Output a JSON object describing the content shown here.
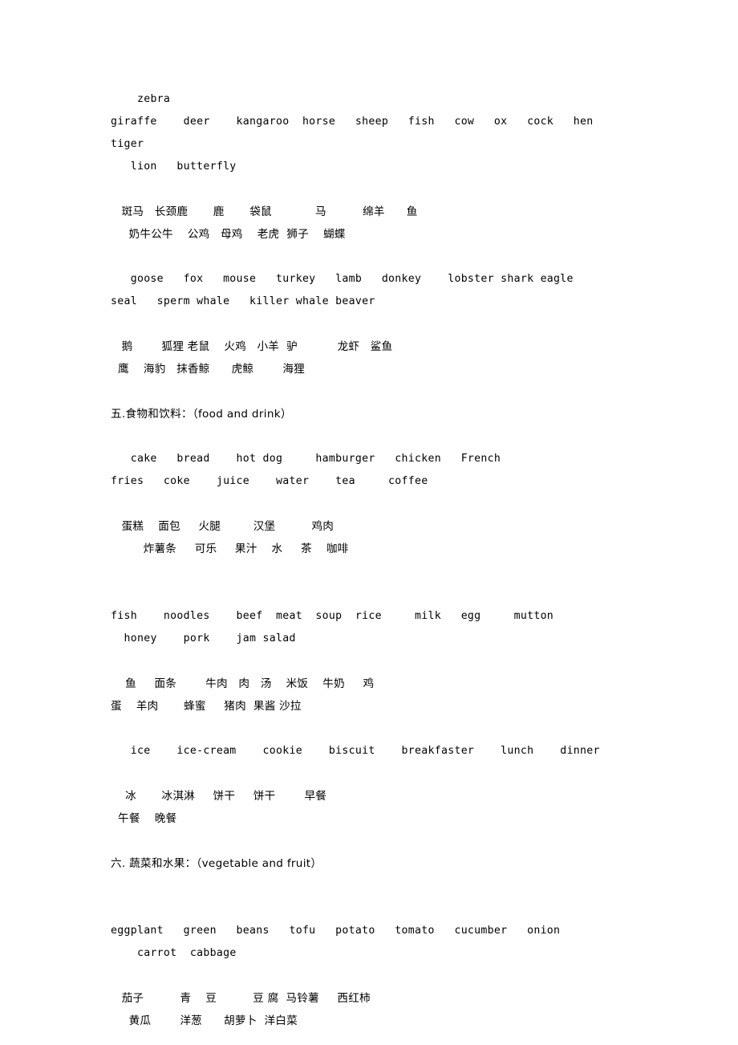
{
  "document": {
    "blocks": [
      {
        "id": "animals-en-1",
        "kind": "english-wordlist",
        "lines": [
          "    zebra",
          "giraffe    deer    kangaroo  horse   sheep   fish   cow   ox   cock   hen   tiger",
          "   lion   butterfly"
        ]
      },
      {
        "id": "gap-1",
        "kind": "blank",
        "lines": [
          ""
        ]
      },
      {
        "id": "animals-cn-1",
        "kind": "chinese-wordlist",
        "lines": [
          "   斑马   长颈鹿       鹿       袋鼠            马          绵羊      鱼",
          "     奶牛公牛    公鸡   母鸡    老虎  狮子    蝴蝶"
        ]
      },
      {
        "id": "gap-2",
        "kind": "blank",
        "lines": [
          ""
        ]
      },
      {
        "id": "animals-en-2",
        "kind": "english-wordlist",
        "lines": [
          "   goose   fox   mouse   turkey   lamb   donkey    lobster shark eagle",
          "seal   sperm whale   killer whale beaver"
        ]
      },
      {
        "id": "gap-3",
        "kind": "blank",
        "lines": [
          ""
        ]
      },
      {
        "id": "animals-cn-2",
        "kind": "chinese-wordlist",
        "lines": [
          "   鹅        狐狸 老鼠    火鸡   小羊  驴           龙虾   鲨鱼",
          "  鹰    海豹   抹香鲸      虎鲸        海狸"
        ]
      },
      {
        "id": "gap-4",
        "kind": "blank",
        "lines": [
          ""
        ]
      },
      {
        "id": "heading-food",
        "kind": "heading",
        "lines": [
          "五.食物和饮料：（food and drink）"
        ]
      },
      {
        "id": "gap-5",
        "kind": "blank",
        "lines": [
          ""
        ]
      },
      {
        "id": "food-en-1",
        "kind": "english-wordlist",
        "lines": [
          "   cake   bread    hot dog     hamburger   chicken   French",
          "fries   coke    juice    water    tea     coffee"
        ]
      },
      {
        "id": "gap-6",
        "kind": "blank",
        "lines": [
          ""
        ]
      },
      {
        "id": "food-cn-1",
        "kind": "chinese-wordlist",
        "lines": [
          "   蛋糕    面包     火腿         汉堡          鸡肉",
          "         炸薯条     可乐     果汁    水     茶    咖啡"
        ]
      },
      {
        "id": "gap-7",
        "kind": "blank",
        "lines": [
          "",
          ""
        ]
      },
      {
        "id": "food-en-2",
        "kind": "english-wordlist",
        "lines": [
          "fish    noodles    beef  meat  soup  rice     milk   egg     mutton",
          "  honey    pork    jam salad"
        ]
      },
      {
        "id": "gap-8",
        "kind": "blank",
        "lines": [
          ""
        ]
      },
      {
        "id": "food-cn-2",
        "kind": "chinese-wordlist",
        "lines": [
          "    鱼     面条        牛肉   肉   汤    米饭    牛奶     鸡",
          "蛋    羊肉       蜂蜜     猪肉  果酱 沙拉"
        ]
      },
      {
        "id": "gap-9",
        "kind": "blank",
        "lines": [
          ""
        ]
      },
      {
        "id": "food-en-3",
        "kind": "english-wordlist",
        "lines": [
          "   ice    ice-cream    cookie    biscuit    breakfaster    lunch    dinner"
        ]
      },
      {
        "id": "gap-10",
        "kind": "blank",
        "lines": [
          ""
        ]
      },
      {
        "id": "food-cn-3",
        "kind": "chinese-wordlist",
        "lines": [
          "    冰       冰淇淋     饼干     饼干        早餐",
          "  午餐    晚餐"
        ]
      },
      {
        "id": "gap-11",
        "kind": "blank",
        "lines": [
          ""
        ]
      },
      {
        "id": "heading-vegetable",
        "kind": "heading",
        "lines": [
          "六. 蔬菜和水果：（vegetable and fruit）"
        ]
      },
      {
        "id": "gap-12",
        "kind": "blank",
        "lines": [
          "",
          ""
        ]
      },
      {
        "id": "veg-en-1",
        "kind": "english-wordlist",
        "lines": [
          "eggplant   green   beans   tofu   potato   tomato   cucumber   onion",
          "    carrot  cabbage"
        ]
      },
      {
        "id": "gap-13",
        "kind": "blank",
        "lines": [
          ""
        ]
      },
      {
        "id": "veg-cn-1",
        "kind": "chinese-wordlist",
        "lines": [
          "   茄子          青    豆          豆 腐  马铃薯     西红柿",
          "     黄瓜        洋葱      胡萝卜  洋白菜"
        ]
      }
    ],
    "vocabulary": {
      "sections": [
        {
          "section_number": "",
          "title_cn": "",
          "title_en": "",
          "english_terms": [
            "zebra",
            "giraffe",
            "deer",
            "kangaroo",
            "horse",
            "sheep",
            "fish",
            "cow",
            "ox",
            "cock",
            "hen",
            "tiger",
            "lion",
            "butterfly"
          ],
          "chinese_terms": [
            "斑马",
            "长颈鹿",
            "鹿",
            "袋鼠",
            "马",
            "绵羊",
            "鱼",
            "奶牛",
            "公牛",
            "公鸡",
            "母鸡",
            "老虎",
            "狮子",
            "蝴蝶"
          ]
        },
        {
          "section_number": "",
          "title_cn": "",
          "title_en": "",
          "english_terms": [
            "goose",
            "fox",
            "mouse",
            "turkey",
            "lamb",
            "donkey",
            "lobster",
            "shark",
            "eagle",
            "seal",
            "sperm whale",
            "killer whale",
            "beaver"
          ],
          "chinese_terms": [
            "鹅",
            "狐狸",
            "老鼠",
            "火鸡",
            "小羊",
            "驴",
            "龙虾",
            "鲨鱼",
            "鹰",
            "海豹",
            "抹香鲸",
            "虎鲸",
            "海狸"
          ]
        },
        {
          "section_number": "五.",
          "title_cn": "食物和饮料：",
          "title_en": "（food and drink）",
          "english_terms": [
            "cake",
            "bread",
            "hot dog",
            "hamburger",
            "chicken",
            "French fries",
            "coke",
            "juice",
            "water",
            "tea",
            "coffee",
            "fish",
            "noodles",
            "beef",
            "meat",
            "soup",
            "rice",
            "milk",
            "egg",
            "mutton",
            "honey",
            "pork",
            "jam",
            "salad",
            "ice",
            "ice-cream",
            "cookie",
            "biscuit",
            "breakfaster",
            "lunch",
            "dinner"
          ],
          "chinese_terms": [
            "蛋糕",
            "面包",
            "火腿",
            "汉堡",
            "鸡肉",
            "炸薯条",
            "可乐",
            "果汁",
            "水",
            "茶",
            "咖啡",
            "鱼",
            "面条",
            "牛肉",
            "肉",
            "汤",
            "米饭",
            "牛奶",
            "鸡蛋",
            "羊肉",
            "蜂蜜",
            "猪肉",
            "果酱",
            "沙拉",
            "冰",
            "冰淇淋",
            "饼干",
            "饼干",
            "早餐",
            "午餐",
            "晚餐"
          ]
        },
        {
          "section_number": "六.",
          "title_cn": " 蔬菜和水果：",
          "title_en": "（vegetable and fruit）",
          "english_terms": [
            "eggplant",
            "green beans",
            "tofu",
            "potato",
            "tomato",
            "cucumber",
            "onion",
            "carrot",
            "cabbage"
          ],
          "chinese_terms": [
            "茄子",
            "青豆",
            "豆腐",
            "马铃薯",
            "西红柿",
            "黄瓜",
            "洋葱",
            "胡萝卜",
            "洋白菜"
          ]
        }
      ]
    }
  }
}
